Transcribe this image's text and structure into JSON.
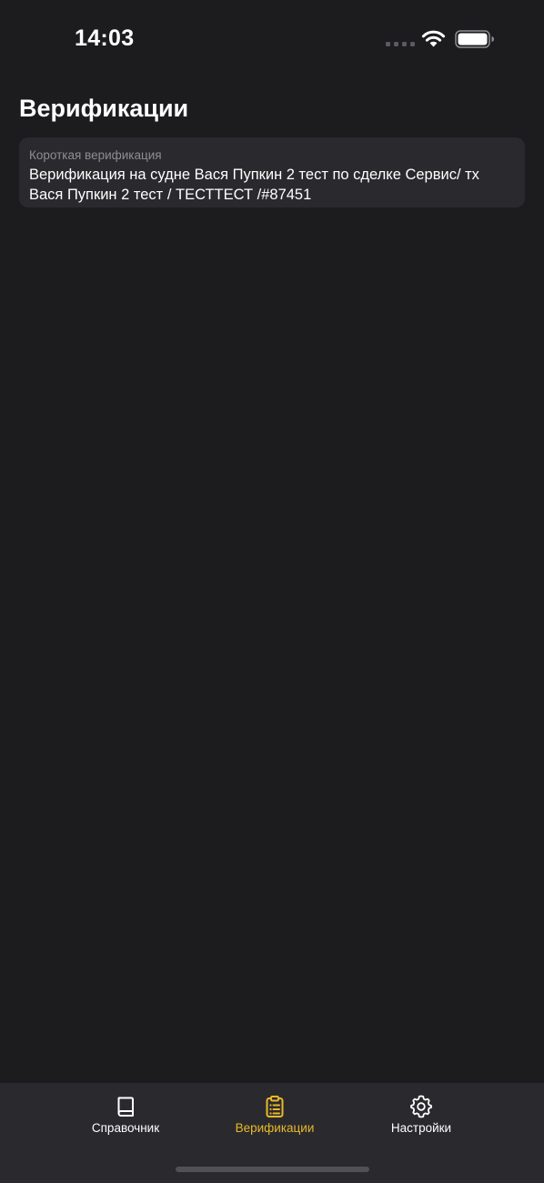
{
  "status_bar": {
    "time": "14:03"
  },
  "page": {
    "title": "Верификации"
  },
  "verifications": [
    {
      "type_label": "Короткая верификация",
      "title": "Верификация на судне Вася Пупкин 2 тест по сделке Сервис/ тх Вася Пупкин 2 тест / ТЕСТТЕСТ /#87451"
    }
  ],
  "tab_bar": {
    "active_tab": "verifications",
    "active_color": "#e8b82a",
    "inactive_color": "#ffffff",
    "tabs": [
      {
        "id": "reference",
        "label": "Справочник",
        "icon": "book-icon"
      },
      {
        "id": "verifications",
        "label": "Верификации",
        "icon": "clipboard-icon"
      },
      {
        "id": "settings",
        "label": "Настройки",
        "icon": "gear-icon"
      }
    ]
  }
}
